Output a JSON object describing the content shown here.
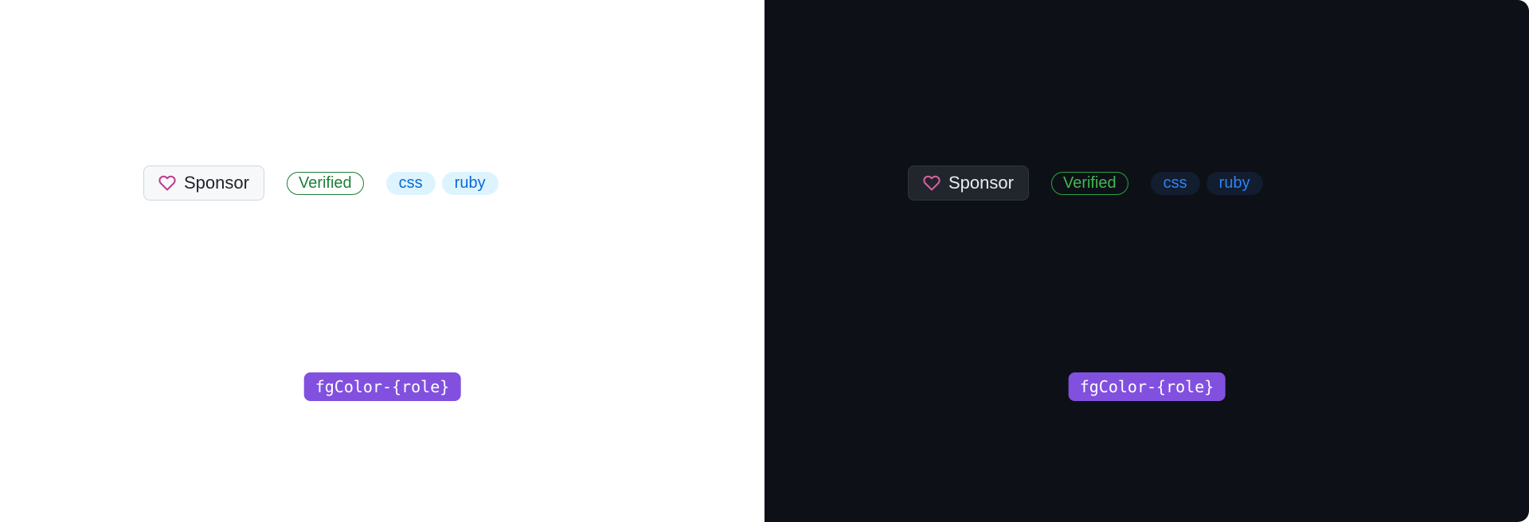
{
  "light": {
    "sponsor_label": "Sponsor",
    "verified_label": "Verified",
    "topics": [
      "css",
      "ruby"
    ],
    "code_label": "fgColor-{role}"
  },
  "dark": {
    "sponsor_label": "Sponsor",
    "verified_label": "Verified",
    "topics": [
      "css",
      "ruby"
    ],
    "code_label": "fgColor-{role}"
  },
  "colors": {
    "light_bg": "#ffffff",
    "dark_bg": "#0d1117",
    "sponsor_heart_light": "#bf3989",
    "sponsor_heart_dark": "#db61a2",
    "verified_light": "#1a7f37",
    "verified_dark": "#3fb950",
    "topic_bg_light": "#ddf4ff",
    "topic_fg_light": "#0969da",
    "topic_bg_dark": "#121d2f",
    "topic_fg_dark": "#2f81f7",
    "chip_bg": "#8250df"
  }
}
